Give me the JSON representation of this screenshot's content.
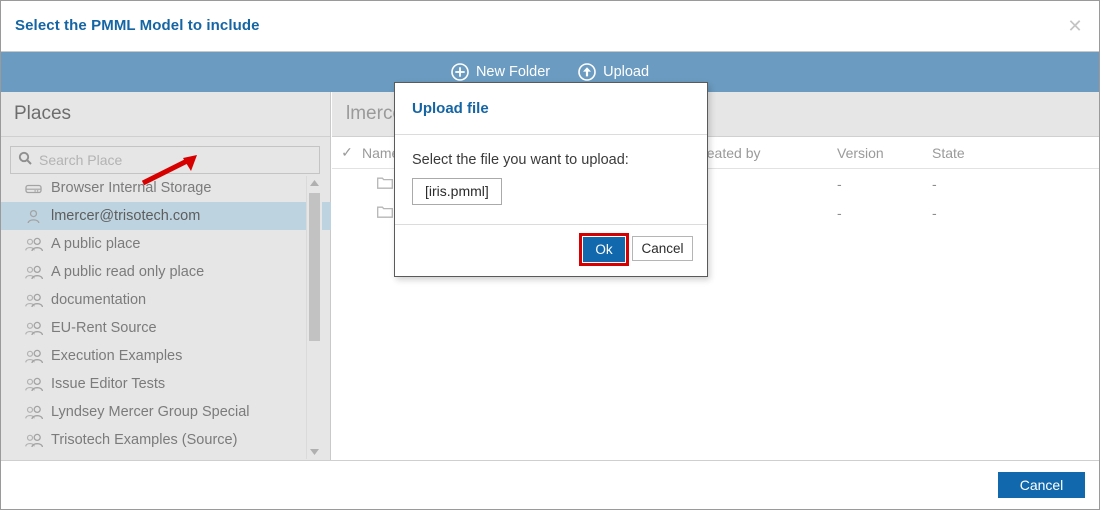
{
  "window": {
    "title": "Select the PMML Model to include",
    "close_label": "✕"
  },
  "toolbar": {
    "new_folder_label": "New Folder",
    "upload_label": "Upload"
  },
  "sidebar": {
    "header": "Places",
    "search": {
      "placeholder": "Search Place",
      "value": ""
    },
    "items": [
      {
        "label": "Browser Internal Storage",
        "icon": "disk-icon",
        "selected": false
      },
      {
        "label": "lmercer@trisotech.com",
        "icon": "user-icon",
        "selected": true
      },
      {
        "label": "A public place",
        "icon": "group-icon",
        "selected": false
      },
      {
        "label": "A public read only place",
        "icon": "group-icon",
        "selected": false
      },
      {
        "label": "documentation",
        "icon": "group-icon",
        "selected": false
      },
      {
        "label": "EU-Rent Source",
        "icon": "group-icon",
        "selected": false
      },
      {
        "label": "Execution Examples",
        "icon": "group-icon",
        "selected": false
      },
      {
        "label": "Issue Editor Tests",
        "icon": "group-icon",
        "selected": false
      },
      {
        "label": "Lyndsey Mercer Group Special",
        "icon": "group-icon",
        "selected": false
      },
      {
        "label": "Trisotech Examples (Source)",
        "icon": "group-icon",
        "selected": false
      }
    ]
  },
  "main": {
    "breadcrumb": "lmercer@trisotech.com",
    "columns": {
      "check": "✓",
      "name": "Name",
      "created_by": "Created by",
      "version": "Version",
      "state": "State"
    },
    "rows": [
      {
        "name": "",
        "created_by": "",
        "version": "-",
        "state": "-"
      },
      {
        "name": "",
        "created_by": "",
        "version": "-",
        "state": "-"
      }
    ]
  },
  "footer": {
    "cancel_label": "Cancel"
  },
  "modal": {
    "title": "Upload file",
    "prompt": "Select the file you want to upload:",
    "file_value": "[iris.pmml]",
    "ok_label": "Ok",
    "cancel_label": "Cancel"
  },
  "colors": {
    "accent_blue": "#1268ac",
    "title_blue": "#1565a4",
    "toolbar_blue": "#6b9bc0",
    "selected_row": "#bed3e0",
    "annotation_red": "#d60000"
  }
}
